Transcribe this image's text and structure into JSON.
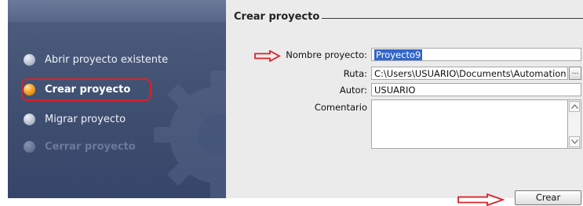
{
  "sidebar": {
    "items": [
      {
        "label": "Abrir proyecto existente",
        "state": "normal"
      },
      {
        "label": "Crear proyecto",
        "state": "active"
      },
      {
        "label": "Migrar proyecto",
        "state": "normal"
      },
      {
        "label": "Cerrar proyecto",
        "state": "disabled"
      }
    ],
    "background_color": "#43537a"
  },
  "form": {
    "title": "Crear proyecto",
    "fields": {
      "nombre": {
        "label": "Nombre proyecto:",
        "value": "Proyecto9"
      },
      "ruta": {
        "label": "Ruta:",
        "value": "C:\\Users\\USUARIO\\Documents\\Automation",
        "browse_label": "..."
      },
      "autor": {
        "label": "Autor:",
        "value": "USUARIO"
      },
      "comentario": {
        "label": "Comentario",
        "value": ""
      }
    },
    "create_button_label": "Crear"
  },
  "annotations": {
    "color": "#d8232a",
    "arrow_icon": "right-arrow-outline",
    "highlight": "rounded-rectangle around Crear proyecto"
  },
  "icons": {
    "nav_bullet_normal": "gray-sphere",
    "nav_bullet_active": "orange-sphere",
    "scroll_up": "scroll-up-arrow",
    "scroll_down": "scroll-down-arrow",
    "background": "gear-watermark"
  }
}
